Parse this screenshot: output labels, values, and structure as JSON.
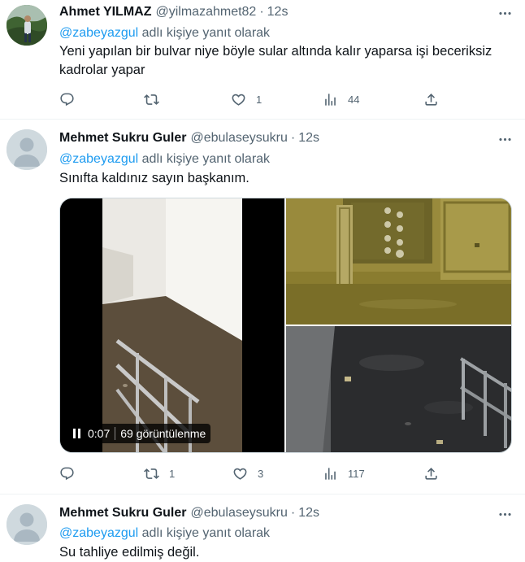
{
  "tweets": [
    {
      "name": "Ahmet YILMAZ",
      "handle": "@yilmazahmet82",
      "separator": "·",
      "time": "12s",
      "reply_mention": "@zabeyazgul",
      "reply_suffix": "adlı kişiye yanıt olarak",
      "text": "Yeni yapılan bir bulvar niye böyle sular altında kalır yaparsa işi beceriksiz kadrolar yapar",
      "replies": "",
      "retweets": "",
      "likes": "1",
      "views": "44"
    },
    {
      "name": "Mehmet Sukru Guler",
      "handle": "@ebulaseysukru",
      "separator": "·",
      "time": "12s",
      "reply_mention": "@zabeyazgul",
      "reply_suffix": "adlı kişiye yanıt olarak",
      "text": "Sınıfta kaldınız sayın başkanım.",
      "replies": "",
      "retweets": "1",
      "likes": "3",
      "views": "117",
      "video": {
        "elapsed": "0:07",
        "views_label": "69 görüntülenme"
      }
    },
    {
      "name": "Mehmet Sukru Guler",
      "handle": "@ebulaseysukru",
      "separator": "·",
      "time": "12s",
      "reply_mention": "@zabeyazgul",
      "reply_suffix": "adlı kişiye yanıt olarak",
      "text": "Su tahliye edilmiş değil."
    }
  ],
  "icons": {
    "reply": "reply-icon",
    "retweet": "retweet-icon",
    "like": "heart-icon",
    "views": "views-icon",
    "share": "share-icon",
    "more": "more-icon"
  },
  "colors": {
    "accent": "#1d9bf0",
    "secondary_text": "#536471",
    "primary_text": "#0f1419",
    "divider": "#eff3f4"
  }
}
